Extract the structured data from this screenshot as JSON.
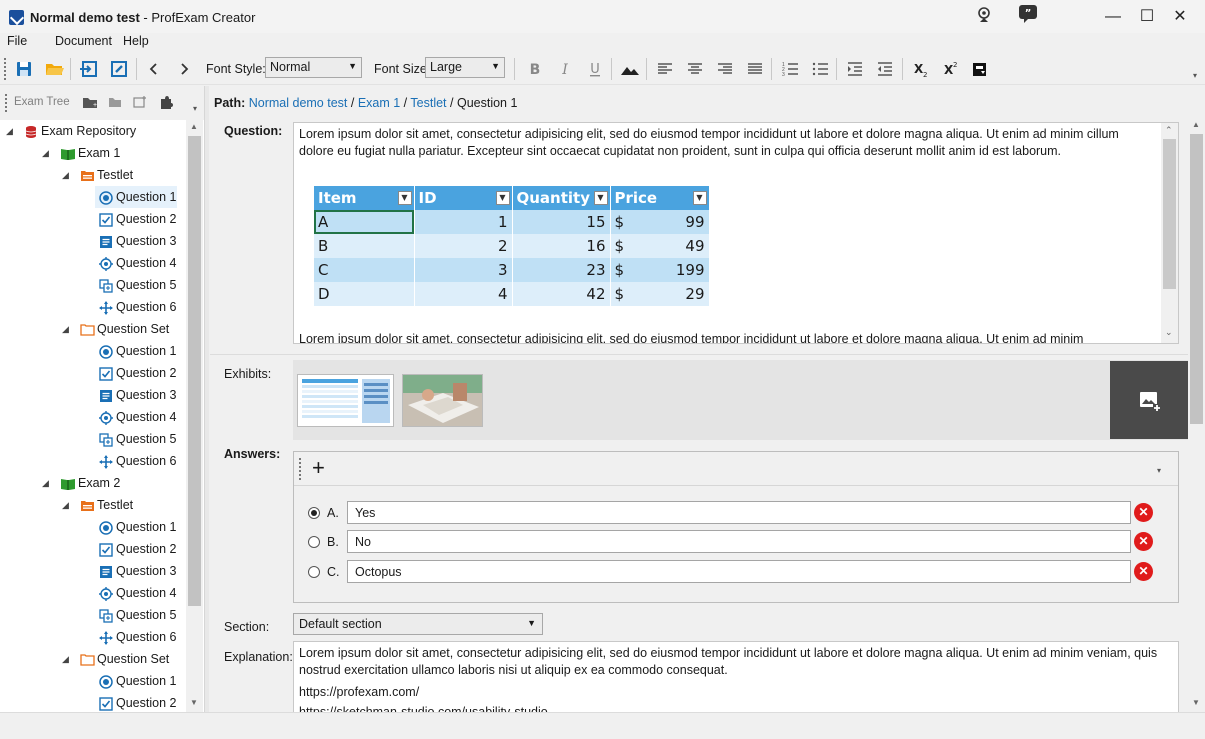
{
  "window": {
    "title_bold": "Normal demo test",
    "title_rest": " - ProfExam Creator"
  },
  "menu": [
    "File",
    "Document",
    "Help"
  ],
  "toolbar": {
    "font_style_label": "Font Style:",
    "font_style_value": "Normal",
    "font_size_label": "Font Size:",
    "font_size_value": "Large"
  },
  "left_panel": {
    "header_label": "Exam Tree",
    "tree": [
      {
        "label": "Exam Repository",
        "icon": "database-icon",
        "level": 0
      },
      {
        "label": "Exam 1",
        "icon": "book-icon",
        "level": 1
      },
      {
        "label": "Testlet",
        "icon": "testlet-icon",
        "level": 2
      },
      {
        "label": "Question 1",
        "icon": "radio-question-icon",
        "level": 3,
        "selected": true
      },
      {
        "label": "Question 2",
        "icon": "checkbox-question-icon",
        "level": 3
      },
      {
        "label": "Question 3",
        "icon": "text-question-icon",
        "level": 3
      },
      {
        "label": "Question 4",
        "icon": "hotspot-question-icon",
        "level": 3
      },
      {
        "label": "Question 5",
        "icon": "drag-drop-question-icon",
        "level": 3
      },
      {
        "label": "Question 6",
        "icon": "move-question-icon",
        "level": 3
      },
      {
        "label": "Question Set",
        "icon": "folder-icon",
        "level": 2
      },
      {
        "label": "Question 1",
        "icon": "radio-question-icon",
        "level": 3
      },
      {
        "label": "Question 2",
        "icon": "checkbox-question-icon",
        "level": 3
      },
      {
        "label": "Question 3",
        "icon": "text-question-icon",
        "level": 3
      },
      {
        "label": "Question 4",
        "icon": "hotspot-question-icon",
        "level": 3
      },
      {
        "label": "Question 5",
        "icon": "drag-drop-question-icon",
        "level": 3
      },
      {
        "label": "Question 6",
        "icon": "move-question-icon",
        "level": 3
      },
      {
        "label": "Exam 2",
        "icon": "book-icon",
        "level": 1
      },
      {
        "label": "Testlet",
        "icon": "testlet-icon",
        "level": 2
      },
      {
        "label": "Question 1",
        "icon": "radio-question-icon",
        "level": 3
      },
      {
        "label": "Question 2",
        "icon": "checkbox-question-icon",
        "level": 3
      },
      {
        "label": "Question 3",
        "icon": "text-question-icon",
        "level": 3
      },
      {
        "label": "Question 4",
        "icon": "hotspot-question-icon",
        "level": 3
      },
      {
        "label": "Question 5",
        "icon": "drag-drop-question-icon",
        "level": 3
      },
      {
        "label": "Question 6",
        "icon": "move-question-icon",
        "level": 3
      },
      {
        "label": "Question Set",
        "icon": "folder-icon",
        "level": 2
      },
      {
        "label": "Question 1",
        "icon": "radio-question-icon",
        "level": 3
      },
      {
        "label": "Question 2",
        "icon": "checkbox-question-icon",
        "level": 3
      }
    ]
  },
  "path": {
    "label": "Path:",
    "crumbs": [
      "Normal demo test",
      "Exam 1",
      "Testlet"
    ],
    "current": "Question 1",
    "sep": " / "
  },
  "question": {
    "label": "Question:",
    "text_top": "Lorem ipsum dolor sit amet, consectetur adipisicing elit, sed do eiusmod tempor incididunt ut labore et dolore magna aliqua. Ut enim ad minim cillum dolore eu fugiat nulla pariatur. Excepteur sint occaecat cupidatat non proident, sunt in culpa qui officia deserunt mollit anim id est laborum.",
    "text_bottom": "Lorem ipsum dolor sit amet, consectetur adipisicing elit, sed do eiusmod tempor incididunt ut labore et dolore magna aliqua. Ut enim ad minim",
    "table": {
      "headers": [
        "Item",
        "ID",
        "Quantity",
        "Price"
      ],
      "rows": [
        [
          "A",
          "1",
          "15",
          "$",
          "99"
        ],
        [
          "B",
          "2",
          "16",
          "$",
          "49"
        ],
        [
          "C",
          "3",
          "23",
          "$",
          "199"
        ],
        [
          "D",
          "4",
          "42",
          "$",
          "29"
        ]
      ]
    }
  },
  "exhibits": {
    "label": "Exhibits:"
  },
  "answers": {
    "label": "Answers:",
    "add": "+",
    "items": [
      {
        "letter": "A.",
        "value": "Yes",
        "checked": true
      },
      {
        "letter": "B.",
        "value": "No",
        "checked": false
      },
      {
        "letter": "C.",
        "value": "Octopus",
        "checked": false
      }
    ],
    "delete_glyph": "✕"
  },
  "section": {
    "label": "Section:",
    "value": "Default section"
  },
  "explanation": {
    "label": "Explanation:",
    "text": "Lorem ipsum dolor sit amet, consectetur adipisicing elit, sed do eiusmod tempor incididunt ut labore et dolore magna aliqua. Ut enim ad minim veniam, quis nostrud exercitation ullamco laboris nisi ut aliquip ex ea commodo consequat.",
    "link1": "https://profexam.com/",
    "link2": "https://sketchman-studio.com/usability-studio"
  },
  "colors": {
    "accent": "#1a6fb5",
    "delete": "#e01b1b",
    "table_header": "#4aa3df"
  }
}
